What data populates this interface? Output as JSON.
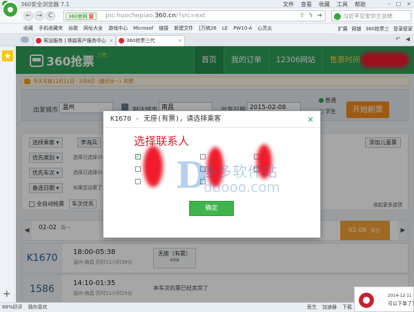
{
  "browser": {
    "title": "360安全浏览器 7.1",
    "menus": [
      "文件",
      "查看",
      "收藏",
      "工具",
      "帮助"
    ],
    "window_controls": [
      "–",
      "□",
      "×"
    ],
    "nav": {
      "back": "←",
      "forward": "→",
      "refresh": "C",
      "home": "⌂"
    },
    "url_tag_green": "360官网",
    "url_tag_red": "证",
    "url_host": "pic.huochepiao.",
    "url_domain": "360.cn",
    "url_path": "/?src=ext",
    "search_text": "习近平见安尔兰总统"
  },
  "bookmarks": [
    "收藏",
    "手机收藏夹",
    "谷歌",
    "网址大全",
    "游戏中心",
    "Microsof",
    "链接",
    "新建文件",
    "[万统26",
    "LE",
    "PW10-A",
    "心灵炎"
  ],
  "bookmarks_right": [
    "扩展",
    "网银",
    "360抢票三",
    "登录管家"
  ],
  "tabs": [
    {
      "label": "客运服务 | 铁路客户服务中心",
      "active": false
    },
    {
      "label": "360抢票三代",
      "active": true
    }
  ],
  "site": {
    "brand": "360抢票",
    "brand_sup": "三代",
    "nav": [
      {
        "label": "首页",
        "active": true
      },
      {
        "label": "我的订单",
        "active": false
      },
      {
        "label": "12306网站",
        "active": false
      },
      {
        "label": "售票时间",
        "active": false,
        "warn": true
      }
    ],
    "notice": "今天可抢12月11日 - 2月8日（腊月廿一）的票"
  },
  "search": {
    "from_label": "出发城市",
    "from_value": "温州",
    "swap_icon": "swap-icon",
    "to_label": "到达城市",
    "to_value": "南昌",
    "date_label": "出发日期",
    "date_value": "2015-02-08",
    "refresh_btn": "开始刷票",
    "radio_normal": "普通",
    "radio_student": "学生"
  },
  "filters": {
    "choose_passenger": "选择乘客",
    "passenger": "李海兵",
    "priority_seat": "优先席别",
    "priority_seat_hint": "选择已选择(0个)",
    "priority_train": "优先车次",
    "priority_train_hint": "选择已选择(0个)",
    "alt_date": "备选日期",
    "alt_date_hint": "如果您设置了多日",
    "add_child": "添加儿童票",
    "auto_grab": "全自动抢票",
    "train_priority": "车次优先",
    "more_options": "收起更多选项"
  },
  "dates": [
    {
      "date": "02-02",
      "weekday": "周一",
      "active": false
    },
    {
      "date": "02-08",
      "weekday": "周日",
      "active": true
    }
  ],
  "trains": [
    {
      "no": "K1670",
      "time": "18:00-05:38",
      "route": "温州-南昌 历时11小时38分",
      "seat": "无座（有票）",
      "price": "¥98"
    },
    {
      "no": "1586",
      "time": "14:10-01:35",
      "route": "温州-南昌 历时11小时25分",
      "soldout": "本车次的票已经卖完了"
    }
  ],
  "modal": {
    "title": "K1670 - 无座(有票)，请选择乘客",
    "close": "×",
    "heading": "选择联系人",
    "watermark_cn": "多多软件站",
    "watermark_en": "ddooo.com",
    "ok_btn": "确定"
  },
  "statusbar": {
    "left": [
      "88%好评",
      "猜你喜欢"
    ],
    "right": [
      "医生",
      "加速器",
      "下载"
    ]
  },
  "toast": {
    "date": "2014-12-11",
    "message": "可以下单了？"
  }
}
